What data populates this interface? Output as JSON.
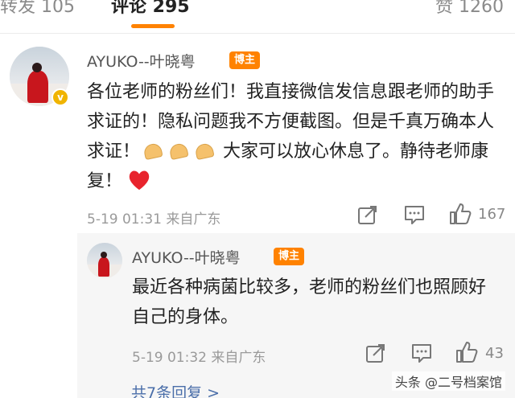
{
  "tabs": {
    "repost": "转发 105",
    "comment": "评论 295",
    "like": "赞 1260"
  },
  "comment": {
    "username": "AYUKO--叶晓粤",
    "badge": "博主",
    "text_before_emoji": "各位老师的粉丝们！我直接微信发信息跟老师的助手求证的！隐私问题我不方便截图。但是千真万确本人求证！",
    "text_after_emoji": "大家可以放心休息了。静待老师康复！",
    "meta": "5-19 01:31 来自广东",
    "like_count": "167"
  },
  "reply": {
    "username": "AYUKO--叶晓粤",
    "badge": "博主",
    "text": "最近各种病菌比较多，老师的粉丝们也照顾好自己的身体。",
    "meta": "5-19 01:32 来自广东",
    "like_count": "43"
  },
  "more_replies": "共7条回复 >",
  "watermark": "头条 @二号档案馆",
  "colors": {
    "accent": "#ff8200",
    "link": "#4a6ea9",
    "heart": "#e8242d",
    "verified": "#f0b400"
  }
}
